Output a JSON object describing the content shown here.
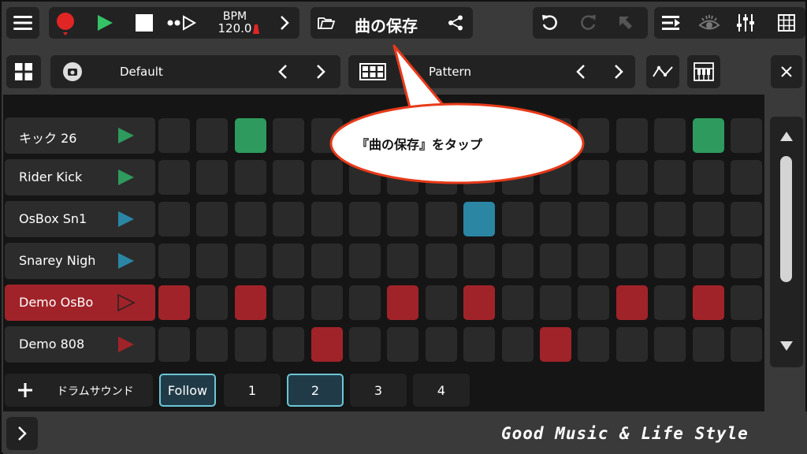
{
  "toolbar": {
    "bpm_label": "BPM",
    "bpm_value": "120.0",
    "song_title": "曲の保存"
  },
  "subbar": {
    "kit_name": "Default",
    "pattern_label": "Pattern"
  },
  "tracks": [
    {
      "name": "キック 26",
      "color": "#2e9a5e",
      "steps": [
        0,
        0,
        1,
        0,
        0,
        0,
        0,
        0,
        0,
        0,
        0,
        0,
        0,
        0,
        1,
        0
      ]
    },
    {
      "name": "Rider Kick",
      "color": "#2e9a5e",
      "steps": [
        0,
        0,
        0,
        0,
        0,
        0,
        0,
        0,
        0,
        0,
        0,
        0,
        0,
        0,
        0,
        0
      ]
    },
    {
      "name": "OsBox Sn1",
      "color": "#2a86a3",
      "steps": [
        0,
        0,
        0,
        0,
        0,
        0,
        0,
        0,
        1,
        0,
        0,
        0,
        0,
        0,
        0,
        0
      ]
    },
    {
      "name": "Snarey Nigh",
      "color": "#2a86a3",
      "steps": [
        0,
        0,
        0,
        0,
        0,
        0,
        0,
        0,
        0,
        0,
        0,
        0,
        0,
        0,
        0,
        0
      ]
    },
    {
      "name": "Demo OsBo",
      "color": "#a02329",
      "selected": true,
      "steps": [
        1,
        0,
        1,
        0,
        0,
        0,
        1,
        0,
        1,
        0,
        0,
        0,
        1,
        0,
        1,
        0
      ]
    },
    {
      "name": "Demo 808",
      "color": "#a02329",
      "steps": [
        0,
        0,
        0,
        0,
        1,
        0,
        0,
        0,
        0,
        0,
        1,
        0,
        0,
        0,
        0,
        0
      ]
    }
  ],
  "bottom": {
    "add_label": "ドラムサウンド",
    "follow_label": "Follow",
    "pages": [
      "1",
      "2",
      "3",
      "4"
    ],
    "active_page": "2"
  },
  "callout": "『曲の保存』をタップ",
  "footer": {
    "tagline": "Good Music & Life Style"
  },
  "colors": {
    "record": "#e02525",
    "play": "#34c265",
    "green_step": "#2e9a5e",
    "blue_step": "#2a86a3",
    "red_step": "#a02329",
    "follow_accent": "#6cc6d6"
  }
}
